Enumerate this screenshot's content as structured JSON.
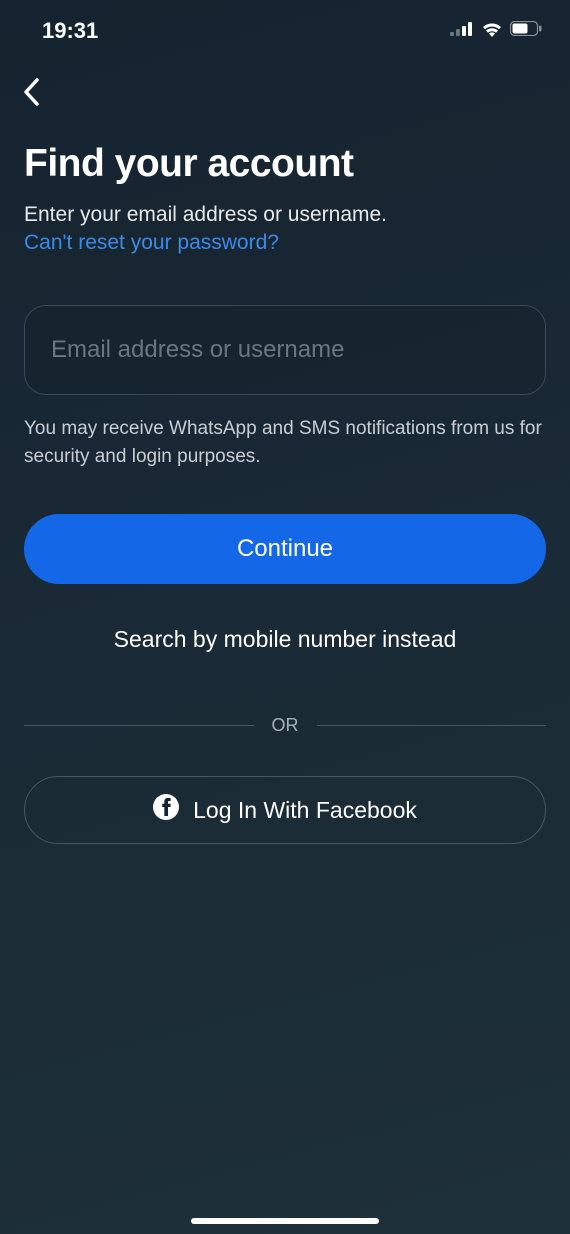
{
  "statusBar": {
    "time": "19:31"
  },
  "header": {
    "title": "Find your account",
    "subtitle": "Enter your email address or username.",
    "resetLink": "Can't reset your password?"
  },
  "form": {
    "inputPlaceholder": "Email address or username",
    "notice": "You may receive WhatsApp and SMS notifications from us for security and login purposes.",
    "continueLabel": "Continue",
    "searchMobileLabel": "Search by mobile number instead"
  },
  "divider": {
    "text": "OR"
  },
  "social": {
    "facebookLabel": "Log In With Facebook"
  }
}
